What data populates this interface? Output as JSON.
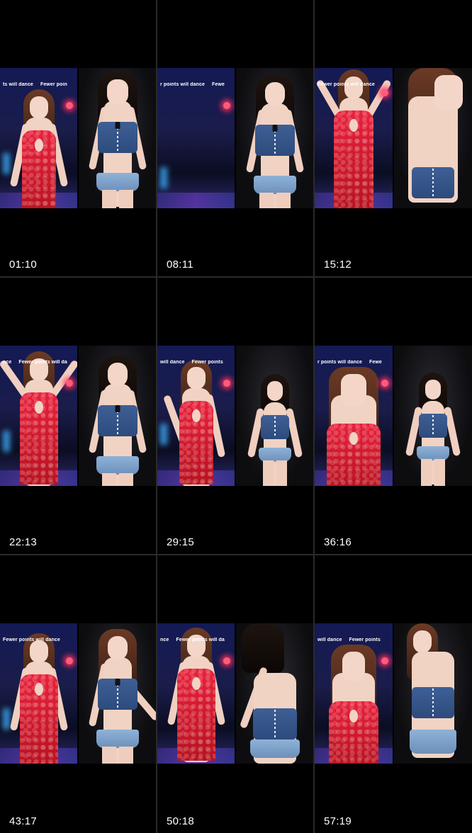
{
  "thumbnails": [
    {
      "time": "01:10",
      "overlay_a": "ts will dance",
      "overlay_b": "Fewer poin"
    },
    {
      "time": "08:11",
      "overlay_a": "r points will dance",
      "overlay_b": "Fewe"
    },
    {
      "time": "15:12",
      "overlay_a": "Fewer points will dance",
      "overlay_b": ""
    },
    {
      "time": "22:13",
      "overlay_a": "nce",
      "overlay_b": "Fewer points will da"
    },
    {
      "time": "29:15",
      "overlay_a": "will dance",
      "overlay_b": "Fewer points"
    },
    {
      "time": "36:16",
      "overlay_a": "r points will dance",
      "overlay_b": "Fewe"
    },
    {
      "time": "43:17",
      "overlay_a": "Fewer points will dance",
      "overlay_b": ""
    },
    {
      "time": "50:18",
      "overlay_a": "nce",
      "overlay_b": "Fewer points will da"
    },
    {
      "time": "57:19",
      "overlay_a": "will dance",
      "overlay_b": "Fewer points"
    }
  ]
}
